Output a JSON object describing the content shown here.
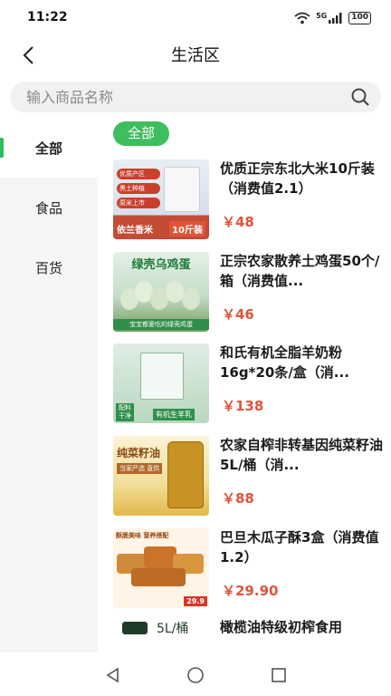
{
  "status": {
    "time": "11:22",
    "network": "5G",
    "battery": "100"
  },
  "header": {
    "title": "生活区"
  },
  "search": {
    "placeholder": "输入商品名称",
    "value": ""
  },
  "sidebar": {
    "items": [
      {
        "label": "全部",
        "active": true
      },
      {
        "label": "食品",
        "active": false
      },
      {
        "label": "百货",
        "active": false
      }
    ]
  },
  "filter": {
    "chip_label": "全部"
  },
  "products": [
    {
      "name": "优质正宗东北大米10斤装（消费值2.1）",
      "price": "￥48"
    },
    {
      "name": "正宗农家散养土鸡蛋50个/箱（消费值...",
      "price": "￥46"
    },
    {
      "name": "和氏有机全脂羊奶粉16g*20条/盒（消...",
      "price": "￥138"
    },
    {
      "name": "农家自榨非转基因纯菜籽油5L/桶（消...",
      "price": "￥88"
    },
    {
      "name": "巴旦木瓜子酥3盒（消费值1.2）",
      "price": "￥29.90"
    },
    {
      "name": "橄榄油特级初榨食用",
      "price": ""
    }
  ],
  "thumbs": {
    "rice": {
      "brand": "依兰香米",
      "size": "10斤装",
      "tags": [
        "优质产区",
        "黑土种植",
        "原米上市"
      ]
    },
    "eggs": {
      "title": "绿壳乌鸡蛋",
      "caption": "宝宝都爱吃的绿壳鸡蛋"
    },
    "milk": {
      "tag": "有机生羊乳",
      "side": "配料干净"
    },
    "oil": {
      "title": "纯菜籽油",
      "sub": "当家严选 直供"
    },
    "snack": {
      "header": "酥脆美味 营养搭配",
      "price": "29.9"
    },
    "olive": {
      "text": "5L/桶"
    }
  },
  "colors": {
    "accent": "#3fbe5e",
    "price": "#e0543a"
  }
}
